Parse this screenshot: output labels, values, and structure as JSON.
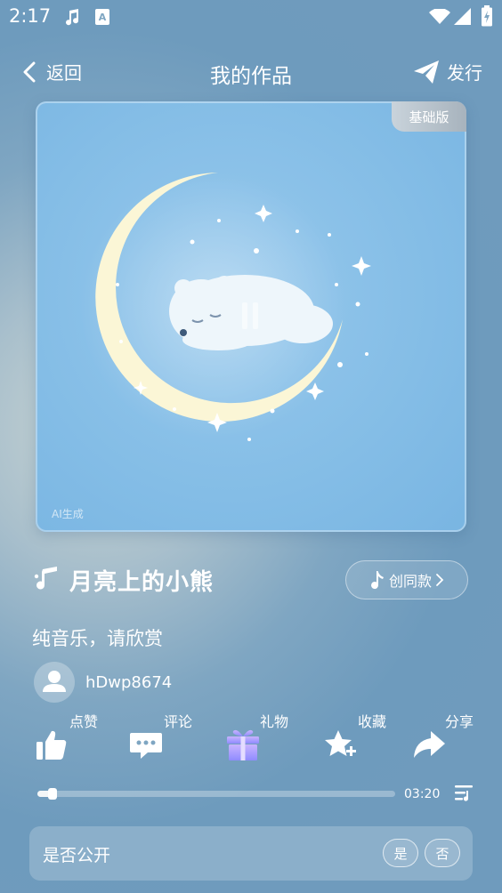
{
  "status_bar": {
    "time": "2:17",
    "icons": [
      "music-note-icon",
      "a-notification-icon",
      "wifi-icon",
      "cellular-signal-icon",
      "battery-charging-icon"
    ]
  },
  "nav": {
    "back_label": "返回",
    "title": "我的作品",
    "publish_label": "发行"
  },
  "cover": {
    "version_badge": "基础版",
    "ai_mark": "AI生成",
    "playback_state": "playing"
  },
  "song": {
    "title": "月亮上的小熊",
    "create_same_label": "创同款",
    "description": "纯音乐，请欣赏"
  },
  "author": {
    "username": "hDwp8674"
  },
  "actions": [
    {
      "label": "点赞",
      "icon": "thumbs-up-icon"
    },
    {
      "label": "评论",
      "icon": "comment-icon"
    },
    {
      "label": "礼物",
      "icon": "gift-icon"
    },
    {
      "label": "收藏",
      "icon": "star-add-icon"
    },
    {
      "label": "分享",
      "icon": "share-icon"
    }
  ],
  "player": {
    "progress_fraction": 0.04,
    "duration": "03:20"
  },
  "public_setting": {
    "label": "是否公开",
    "yes_label": "是",
    "no_label": "否"
  },
  "colors": {
    "background": "#7fa6c2",
    "cover_bg": "#84bde6",
    "moon": "#fbf6d6",
    "gift_gradient_start": "#b9a6ff",
    "gift_gradient_end": "#8f8bff"
  }
}
